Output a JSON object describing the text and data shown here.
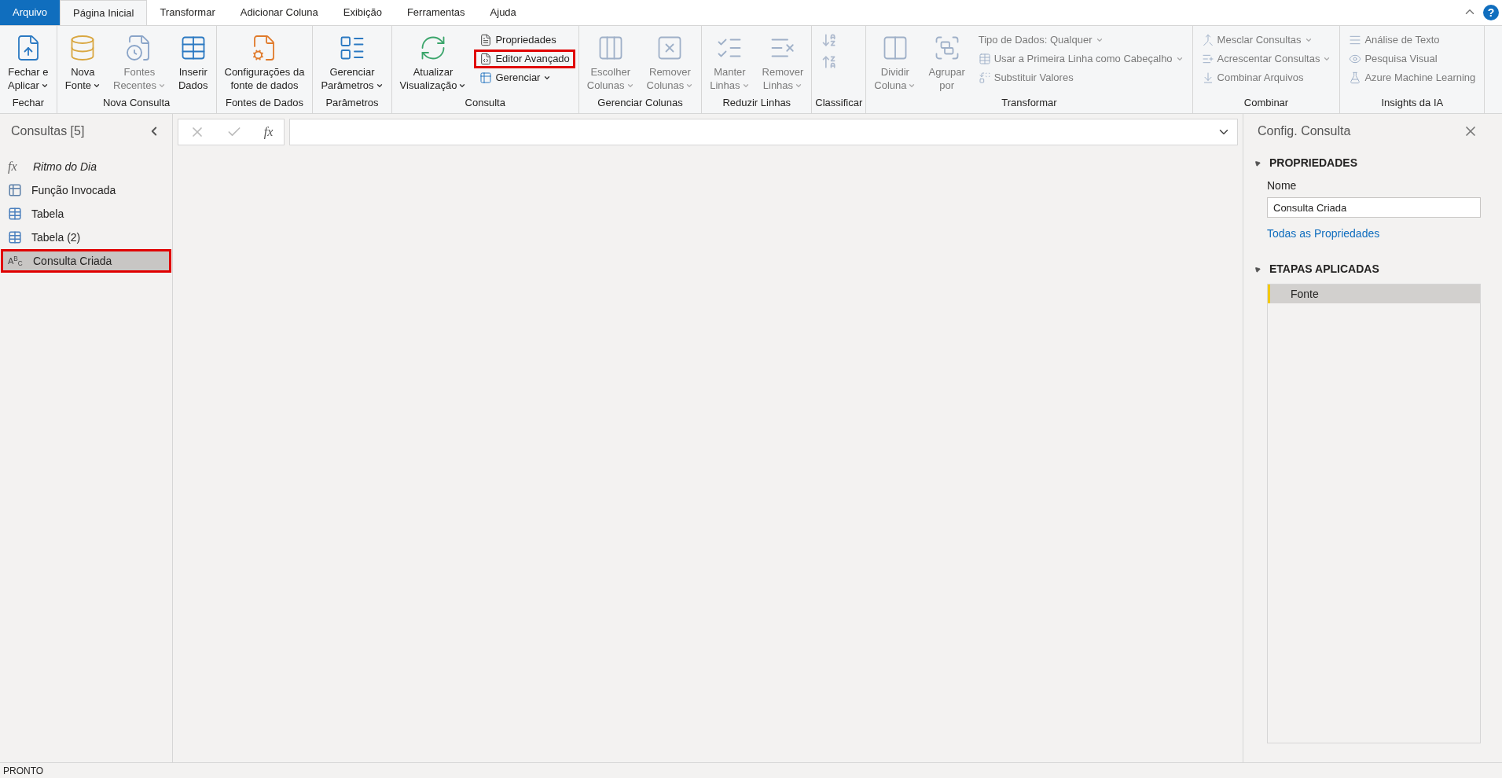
{
  "tabs": [
    {
      "label": "Arquivo",
      "kind": "file",
      "selected": false
    },
    {
      "label": "Página Inicial",
      "kind": "tab",
      "selected": true
    },
    {
      "label": "Transformar",
      "kind": "tab",
      "selected": false
    },
    {
      "label": "Adicionar Coluna",
      "kind": "tab",
      "selected": false
    },
    {
      "label": "Exibição",
      "kind": "tab",
      "selected": false
    },
    {
      "label": "Ferramentas",
      "kind": "tab",
      "selected": false
    },
    {
      "label": "Ajuda",
      "kind": "tab",
      "selected": false
    }
  ],
  "help_label": "?",
  "ribbon_groups": [
    {
      "label": "Fechar",
      "items": [
        {
          "kind": "large",
          "lines": [
            "Fechar e",
            "Aplicar"
          ],
          "dropdown": true,
          "disabled": false,
          "highlighted": false
        }
      ]
    },
    {
      "label": "Nova Consulta",
      "items": [
        {
          "kind": "large",
          "lines": [
            "Nova",
            "Fonte"
          ],
          "dropdown": true,
          "disabled": false,
          "highlighted": false
        },
        {
          "kind": "large",
          "lines": [
            "Fontes",
            "Recentes"
          ],
          "dropdown": true,
          "disabled": true,
          "highlighted": false
        },
        {
          "kind": "large",
          "lines": [
            "Inserir",
            "Dados"
          ],
          "dropdown": false,
          "disabled": false,
          "highlighted": false
        }
      ]
    },
    {
      "label": "Fontes de Dados",
      "items": [
        {
          "kind": "large",
          "lines": [
            "Configurações da",
            "fonte de dados"
          ],
          "dropdown": false,
          "disabled": false,
          "highlighted": false
        }
      ]
    },
    {
      "label": "Parâmetros",
      "items": [
        {
          "kind": "large",
          "lines": [
            "Gerenciar",
            "Parâmetros"
          ],
          "dropdown": true,
          "disabled": false,
          "highlighted": false
        }
      ]
    },
    {
      "label": "Consulta",
      "items": [
        {
          "kind": "large",
          "lines": [
            "Atualizar",
            "Visualização"
          ],
          "dropdown": true,
          "disabled": false,
          "highlighted": false
        },
        {
          "kind": "small",
          "lines": [
            "Propriedades"
          ],
          "dropdown": false,
          "disabled": false,
          "highlighted": false
        },
        {
          "kind": "small",
          "lines": [
            "Editor Avançado"
          ],
          "dropdown": false,
          "disabled": false,
          "highlighted": true
        },
        {
          "kind": "small",
          "lines": [
            "Gerenciar"
          ],
          "dropdown": true,
          "disabled": false,
          "highlighted": false
        }
      ]
    },
    {
      "label": "Gerenciar Colunas",
      "items": [
        {
          "kind": "large",
          "lines": [
            "Escolher",
            "Colunas"
          ],
          "dropdown": true,
          "disabled": true,
          "highlighted": false
        },
        {
          "kind": "large",
          "lines": [
            "Remover",
            "Colunas"
          ],
          "dropdown": true,
          "disabled": true,
          "highlighted": false
        }
      ]
    },
    {
      "label": "Reduzir Linhas",
      "items": [
        {
          "kind": "large",
          "lines": [
            "Manter",
            "Linhas"
          ],
          "dropdown": true,
          "disabled": true,
          "highlighted": false
        },
        {
          "kind": "large",
          "lines": [
            "Remover",
            "Linhas"
          ],
          "dropdown": true,
          "disabled": true,
          "highlighted": false
        }
      ]
    },
    {
      "label": "Classificar",
      "items": [
        {
          "kind": "sort",
          "disabled": true
        }
      ]
    },
    {
      "label": "Transformar",
      "items": [
        {
          "kind": "large",
          "lines": [
            "Dividir",
            "Coluna"
          ],
          "dropdown": true,
          "disabled": true,
          "highlighted": false
        },
        {
          "kind": "large",
          "lines": [
            "Agrupar",
            "por"
          ],
          "dropdown": false,
          "disabled": true,
          "highlighted": false
        },
        {
          "kind": "small-text",
          "lines": [
            "Tipo de Dados: Qualquer"
          ],
          "dropdown": true,
          "disabled": true,
          "highlighted": false
        },
        {
          "kind": "small",
          "lines": [
            "Usar a Primeira Linha como Cabeçalho"
          ],
          "dropdown": true,
          "disabled": true,
          "highlighted": false
        },
        {
          "kind": "small",
          "lines": [
            "Substituir Valores"
          ],
          "dropdown": false,
          "disabled": true,
          "highlighted": false
        }
      ]
    },
    {
      "label": "Combinar",
      "items": [
        {
          "kind": "small",
          "lines": [
            "Mesclar Consultas"
          ],
          "dropdown": true,
          "disabled": true,
          "highlighted": false
        },
        {
          "kind": "small",
          "lines": [
            "Acrescentar Consultas"
          ],
          "dropdown": true,
          "disabled": true,
          "highlighted": false
        },
        {
          "kind": "small",
          "lines": [
            "Combinar Arquivos"
          ],
          "dropdown": false,
          "disabled": true,
          "highlighted": false
        }
      ]
    },
    {
      "label": "Insights da IA",
      "items": [
        {
          "kind": "small",
          "lines": [
            "Análise de Texto"
          ],
          "dropdown": false,
          "disabled": true,
          "highlighted": false
        },
        {
          "kind": "small",
          "lines": [
            "Pesquisa Visual"
          ],
          "dropdown": false,
          "disabled": true,
          "highlighted": false
        },
        {
          "kind": "small",
          "lines": [
            "Azure Machine Learning"
          ],
          "dropdown": false,
          "disabled": true,
          "highlighted": false
        }
      ]
    }
  ],
  "queries_panel": {
    "title": "Consultas [5]",
    "queries": [
      {
        "name": "Ritmo do Dia",
        "kind": "function",
        "icon_text": "fx",
        "selected": false,
        "highlighted": false
      },
      {
        "name": "Função Invocada",
        "kind": "invoked",
        "selected": false,
        "highlighted": false
      },
      {
        "name": "Tabela",
        "kind": "table",
        "selected": false,
        "highlighted": false
      },
      {
        "name": "Tabela (2)",
        "kind": "table",
        "selected": false,
        "highlighted": false
      },
      {
        "name": "Consulta Criada",
        "kind": "text",
        "icon_text": "A$^{B}$$_{C}$",
        "selected": true,
        "highlighted": true
      }
    ]
  },
  "formula_bar": {
    "fx_label": "fx"
  },
  "settings_panel": {
    "title": "Config. Consulta",
    "properties_heading": "PROPRIEDADES",
    "name_label": "Nome",
    "name_value": "Consulta Criada",
    "all_properties_link": "Todas as Propriedades",
    "steps_heading": "ETAPAS APLICADAS",
    "steps": [
      {
        "label": "Fonte",
        "selected": true
      }
    ]
  },
  "status_bar": {
    "text": "PRONTO"
  }
}
